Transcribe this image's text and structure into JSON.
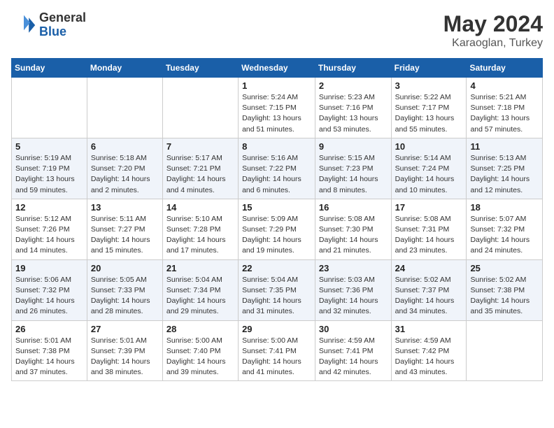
{
  "header": {
    "logo_general": "General",
    "logo_blue": "Blue",
    "month": "May 2024",
    "location": "Karaoglan, Turkey"
  },
  "weekdays": [
    "Sunday",
    "Monday",
    "Tuesday",
    "Wednesday",
    "Thursday",
    "Friday",
    "Saturday"
  ],
  "weeks": [
    [
      {
        "day": "",
        "sunrise": "",
        "sunset": "",
        "daylight": ""
      },
      {
        "day": "",
        "sunrise": "",
        "sunset": "",
        "daylight": ""
      },
      {
        "day": "",
        "sunrise": "",
        "sunset": "",
        "daylight": ""
      },
      {
        "day": "1",
        "sunrise": "Sunrise: 5:24 AM",
        "sunset": "Sunset: 7:15 PM",
        "daylight": "Daylight: 13 hours and 51 minutes."
      },
      {
        "day": "2",
        "sunrise": "Sunrise: 5:23 AM",
        "sunset": "Sunset: 7:16 PM",
        "daylight": "Daylight: 13 hours and 53 minutes."
      },
      {
        "day": "3",
        "sunrise": "Sunrise: 5:22 AM",
        "sunset": "Sunset: 7:17 PM",
        "daylight": "Daylight: 13 hours and 55 minutes."
      },
      {
        "day": "4",
        "sunrise": "Sunrise: 5:21 AM",
        "sunset": "Sunset: 7:18 PM",
        "daylight": "Daylight: 13 hours and 57 minutes."
      }
    ],
    [
      {
        "day": "5",
        "sunrise": "Sunrise: 5:19 AM",
        "sunset": "Sunset: 7:19 PM",
        "daylight": "Daylight: 13 hours and 59 minutes."
      },
      {
        "day": "6",
        "sunrise": "Sunrise: 5:18 AM",
        "sunset": "Sunset: 7:20 PM",
        "daylight": "Daylight: 14 hours and 2 minutes."
      },
      {
        "day": "7",
        "sunrise": "Sunrise: 5:17 AM",
        "sunset": "Sunset: 7:21 PM",
        "daylight": "Daylight: 14 hours and 4 minutes."
      },
      {
        "day": "8",
        "sunrise": "Sunrise: 5:16 AM",
        "sunset": "Sunset: 7:22 PM",
        "daylight": "Daylight: 14 hours and 6 minutes."
      },
      {
        "day": "9",
        "sunrise": "Sunrise: 5:15 AM",
        "sunset": "Sunset: 7:23 PM",
        "daylight": "Daylight: 14 hours and 8 minutes."
      },
      {
        "day": "10",
        "sunrise": "Sunrise: 5:14 AM",
        "sunset": "Sunset: 7:24 PM",
        "daylight": "Daylight: 14 hours and 10 minutes."
      },
      {
        "day": "11",
        "sunrise": "Sunrise: 5:13 AM",
        "sunset": "Sunset: 7:25 PM",
        "daylight": "Daylight: 14 hours and 12 minutes."
      }
    ],
    [
      {
        "day": "12",
        "sunrise": "Sunrise: 5:12 AM",
        "sunset": "Sunset: 7:26 PM",
        "daylight": "Daylight: 14 hours and 14 minutes."
      },
      {
        "day": "13",
        "sunrise": "Sunrise: 5:11 AM",
        "sunset": "Sunset: 7:27 PM",
        "daylight": "Daylight: 14 hours and 15 minutes."
      },
      {
        "day": "14",
        "sunrise": "Sunrise: 5:10 AM",
        "sunset": "Sunset: 7:28 PM",
        "daylight": "Daylight: 14 hours and 17 minutes."
      },
      {
        "day": "15",
        "sunrise": "Sunrise: 5:09 AM",
        "sunset": "Sunset: 7:29 PM",
        "daylight": "Daylight: 14 hours and 19 minutes."
      },
      {
        "day": "16",
        "sunrise": "Sunrise: 5:08 AM",
        "sunset": "Sunset: 7:30 PM",
        "daylight": "Daylight: 14 hours and 21 minutes."
      },
      {
        "day": "17",
        "sunrise": "Sunrise: 5:08 AM",
        "sunset": "Sunset: 7:31 PM",
        "daylight": "Daylight: 14 hours and 23 minutes."
      },
      {
        "day": "18",
        "sunrise": "Sunrise: 5:07 AM",
        "sunset": "Sunset: 7:32 PM",
        "daylight": "Daylight: 14 hours and 24 minutes."
      }
    ],
    [
      {
        "day": "19",
        "sunrise": "Sunrise: 5:06 AM",
        "sunset": "Sunset: 7:32 PM",
        "daylight": "Daylight: 14 hours and 26 minutes."
      },
      {
        "day": "20",
        "sunrise": "Sunrise: 5:05 AM",
        "sunset": "Sunset: 7:33 PM",
        "daylight": "Daylight: 14 hours and 28 minutes."
      },
      {
        "day": "21",
        "sunrise": "Sunrise: 5:04 AM",
        "sunset": "Sunset: 7:34 PM",
        "daylight": "Daylight: 14 hours and 29 minutes."
      },
      {
        "day": "22",
        "sunrise": "Sunrise: 5:04 AM",
        "sunset": "Sunset: 7:35 PM",
        "daylight": "Daylight: 14 hours and 31 minutes."
      },
      {
        "day": "23",
        "sunrise": "Sunrise: 5:03 AM",
        "sunset": "Sunset: 7:36 PM",
        "daylight": "Daylight: 14 hours and 32 minutes."
      },
      {
        "day": "24",
        "sunrise": "Sunrise: 5:02 AM",
        "sunset": "Sunset: 7:37 PM",
        "daylight": "Daylight: 14 hours and 34 minutes."
      },
      {
        "day": "25",
        "sunrise": "Sunrise: 5:02 AM",
        "sunset": "Sunset: 7:38 PM",
        "daylight": "Daylight: 14 hours and 35 minutes."
      }
    ],
    [
      {
        "day": "26",
        "sunrise": "Sunrise: 5:01 AM",
        "sunset": "Sunset: 7:38 PM",
        "daylight": "Daylight: 14 hours and 37 minutes."
      },
      {
        "day": "27",
        "sunrise": "Sunrise: 5:01 AM",
        "sunset": "Sunset: 7:39 PM",
        "daylight": "Daylight: 14 hours and 38 minutes."
      },
      {
        "day": "28",
        "sunrise": "Sunrise: 5:00 AM",
        "sunset": "Sunset: 7:40 PM",
        "daylight": "Daylight: 14 hours and 39 minutes."
      },
      {
        "day": "29",
        "sunrise": "Sunrise: 5:00 AM",
        "sunset": "Sunset: 7:41 PM",
        "daylight": "Daylight: 14 hours and 41 minutes."
      },
      {
        "day": "30",
        "sunrise": "Sunrise: 4:59 AM",
        "sunset": "Sunset: 7:41 PM",
        "daylight": "Daylight: 14 hours and 42 minutes."
      },
      {
        "day": "31",
        "sunrise": "Sunrise: 4:59 AM",
        "sunset": "Sunset: 7:42 PM",
        "daylight": "Daylight: 14 hours and 43 minutes."
      },
      {
        "day": "",
        "sunrise": "",
        "sunset": "",
        "daylight": ""
      }
    ]
  ]
}
